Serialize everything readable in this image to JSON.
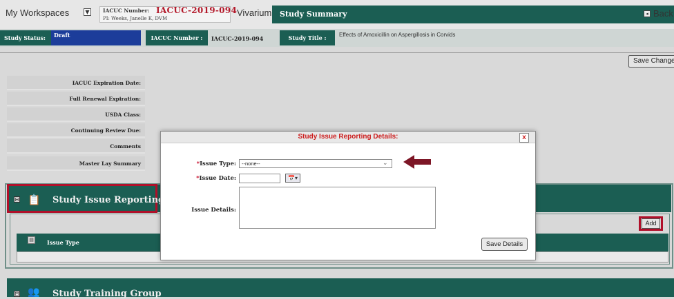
{
  "header": {
    "workspaces_label": "My Workspaces",
    "workspaces_dropdown_glyph": "▼",
    "iacuc_number_label": "IACUC Number:",
    "iacuc_number_value": "IACUC-2019-094",
    "pi_text": "PI: Weeks, Janelle K, DVM",
    "vivarium_label": "Vivarium",
    "page_title": "Study Summary",
    "back_label": "Back",
    "back_icon": "◂"
  },
  "status": {
    "study_status_label": "Study Status:",
    "study_status_value": "Draft",
    "iacuc_number_label": "IACUC Number :",
    "iacuc_number_value": "IACUC-2019-094",
    "study_title_label": "Study Title :",
    "study_title_value": "Effects of Amoxicillin on Aspergillosis in Corvids"
  },
  "actions": {
    "save_changes": "Save Changes"
  },
  "fields": [
    "IACUC Expiration Date:",
    "Full Renewal Expiration:",
    "USDA Class:",
    "Continuing Review Due:",
    "Comments",
    "Master Lay Summary"
  ],
  "issue_section": {
    "toggle": "⊟",
    "icon": "clipboard-people-icon",
    "title": "Study Issue Reporting",
    "add_label": "Add",
    "table_columns": [
      "Issue Type"
    ],
    "colors": {
      "section": "#1b5e53",
      "highlight": "#b0102a"
    }
  },
  "training_section": {
    "toggle": "⊟",
    "icon": "people-group-icon",
    "title": "Study Training Group"
  },
  "modal": {
    "title": "Study Issue Reporting Details:",
    "close_label": "x",
    "required_mark": "*",
    "issue_type_label": "Issue Type:",
    "issue_type_value": "--none--",
    "issue_date_label": "Issue Date:",
    "issue_date_value": "",
    "issue_details_label": "Issue Details:",
    "issue_details_value": "",
    "save_details_label": "Save Details",
    "arrow_color": "#7d1626"
  }
}
